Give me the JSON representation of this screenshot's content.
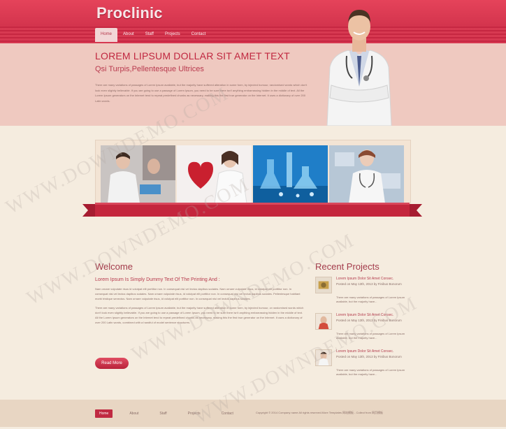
{
  "brand": {
    "logo": "Proclinic"
  },
  "nav": {
    "items": [
      "Home",
      "About",
      "Staff",
      "Projects",
      "Contact"
    ],
    "active": "Home"
  },
  "hero": {
    "title": "LOREM LIPSUM DOLLAR SIT AMET TEXT",
    "subtitle": "Qsi Turpis,Pellentesque Ultrices",
    "text": "There are many variations of passages of Lorem Ipsum available, but the majority have suffered alteration in some form, by injected humour, randomised words which don't look even slightly believable. If you are going to use a passage of Lorem Ipsum, you need to be sure there isn't anything embarrassing hidden in the middle of text. All the Lorem Ipsum generators on the Internet tend to repeat predefined chunks as necessary, making this the first true generator on the Internet. It uses a dictionary of over 200 Latin words."
  },
  "welcome": {
    "title": "Welcome",
    "subtitle": "Lorem Ipsum Is Simply Dummy Text Of The Printing And :",
    "p1": "Nam ornare vulputate risus id volutpat elit porttitor non. In consequat nisi vel lectus dapibus sodales. Nam ornare vulputate risus, id volutpat elit porttitor non. In consequat nisi vel lectus dapibus sodales. Nam ornare vulputate risus, id volutpat elit porttitor non. In consequat nisi vel lectus dapibus sodales. Pellentesque habitant morbi tristique senectus. Nam ornare vulputate risus, id volutpat elit porttitor non. In consequat nisi vel lectus dapibus sodales.",
    "p2": "There are many variations of passages of Lorem Ipsum available, but the majority have suffered alteration in some form, by injected humour, or randomised words which don't look even slightly believable. If you are going to use a passage of Lorem Ipsum, you need to be sure there isn't anything embarrassing hidden in the middle of text. All the Lorem Ipsum generators on the Internet tend to repeat predefined chunks as necessary, making this the first true generator on the Internet. It uses a dictionary of over 200 Latin words, combined with a handful of model sentence structures.",
    "button": "Read More"
  },
  "recent": {
    "title": "Recent Projects",
    "items": [
      {
        "title": "Lorem Ipsum Dolor Sit Amet Consec.",
        "date": "Posted on May 13th, 2013 by Finibus Bonorum",
        "text": "There are many variations of passages of Lorem Ipsum available, but the majority have..."
      },
      {
        "title": "Lorem Ipsum Dolor Sit Amet Consec.",
        "date": "Posted on May 13th, 2013 by Finibus Bonorum",
        "text": "There are many variations of passages of Lorem Ipsum available, but the majority have..."
      },
      {
        "title": "Lorem Ipsum Dolor Sit Amet Consec.",
        "date": "Posted on May 13th, 2013 by Finibus Bonorum",
        "text": "There are many variations of passages of Lorem Ipsum available, but the majority have..."
      }
    ]
  },
  "footer": {
    "nav": [
      "Home",
      "About",
      "Staff",
      "Projects",
      "Contact"
    ],
    "copyright": "Copyright © 2014 Company name All rights reserved.More Templates 网站模板 - Collect from 网页模板"
  },
  "watermark": "WWW.DOWNDEMO.COM"
}
